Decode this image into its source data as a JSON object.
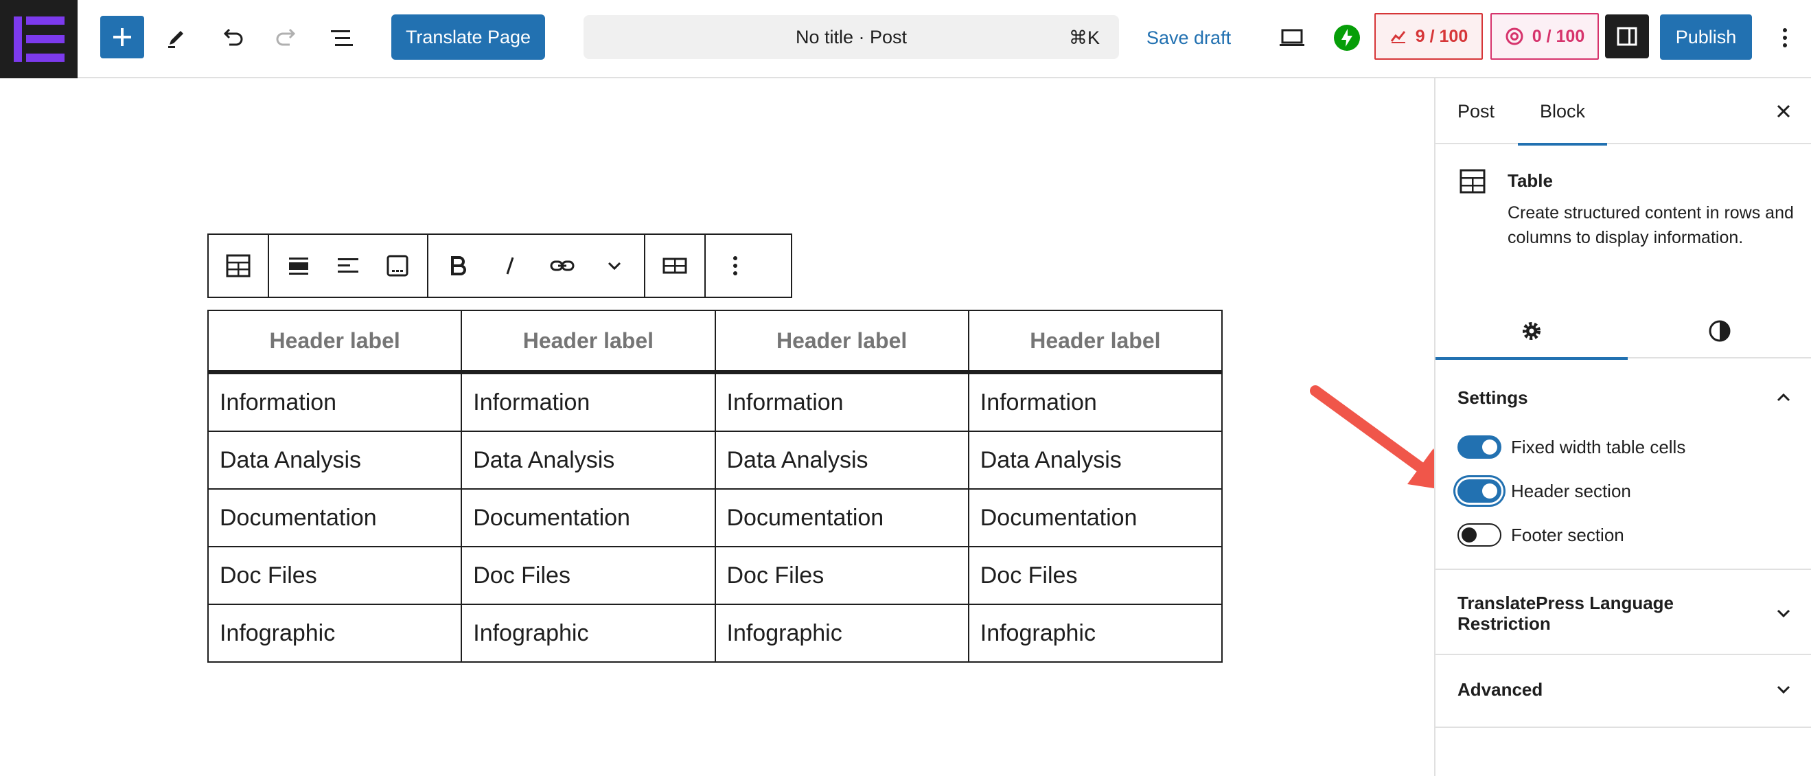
{
  "topbar": {
    "translate_label": "Translate Page",
    "document_title": "No title · Post",
    "shortcut": "⌘K",
    "save_draft_label": "Save draft",
    "seo_score": "9 / 100",
    "readability_score": "0 / 100",
    "publish_label": "Publish",
    "colors": {
      "primary": "#2271b1",
      "brand_purple": "#7c3aed",
      "score_red": "#d63638",
      "score_pink": "#d6336c",
      "jetpack_green": "#069e08"
    }
  },
  "block_toolbar": {
    "icons": [
      "table-icon",
      "align-center-icon",
      "align-left-icon",
      "caption-icon",
      "bold-icon",
      "italic-icon",
      "link-icon",
      "more-format-chevron-icon",
      "edit-table-icon",
      "more-options-icon"
    ]
  },
  "table": {
    "headers": [
      "Header label",
      "Header label",
      "Header label",
      "Header label"
    ],
    "rows": [
      [
        "Information",
        "Information",
        "Information",
        "Information"
      ],
      [
        "Data Analysis",
        "Data Analysis",
        "Data Analysis",
        "Data Analysis"
      ],
      [
        "Documentation",
        "Documentation",
        "Documentation",
        "Documentation"
      ],
      [
        "Doc Files",
        "Doc Files",
        "Doc Files",
        "Doc Files"
      ],
      [
        "Infographic",
        "Infographic",
        "Infographic",
        "Infographic"
      ]
    ]
  },
  "sidebar": {
    "tabs": [
      {
        "label": "Post",
        "active": false
      },
      {
        "label": "Block",
        "active": true
      }
    ],
    "block": {
      "title": "Table",
      "description": "Create structured content in rows and columns to display information."
    },
    "settings_panel": {
      "title": "Settings",
      "toggles": [
        {
          "label": "Fixed width table cells",
          "checked": true
        },
        {
          "label": "Header section",
          "checked": true
        },
        {
          "label": "Footer section",
          "checked": false
        }
      ]
    },
    "translatepress_panel": {
      "title": "TranslatePress Language Restriction"
    },
    "advanced_panel": {
      "title": "Advanced"
    }
  }
}
